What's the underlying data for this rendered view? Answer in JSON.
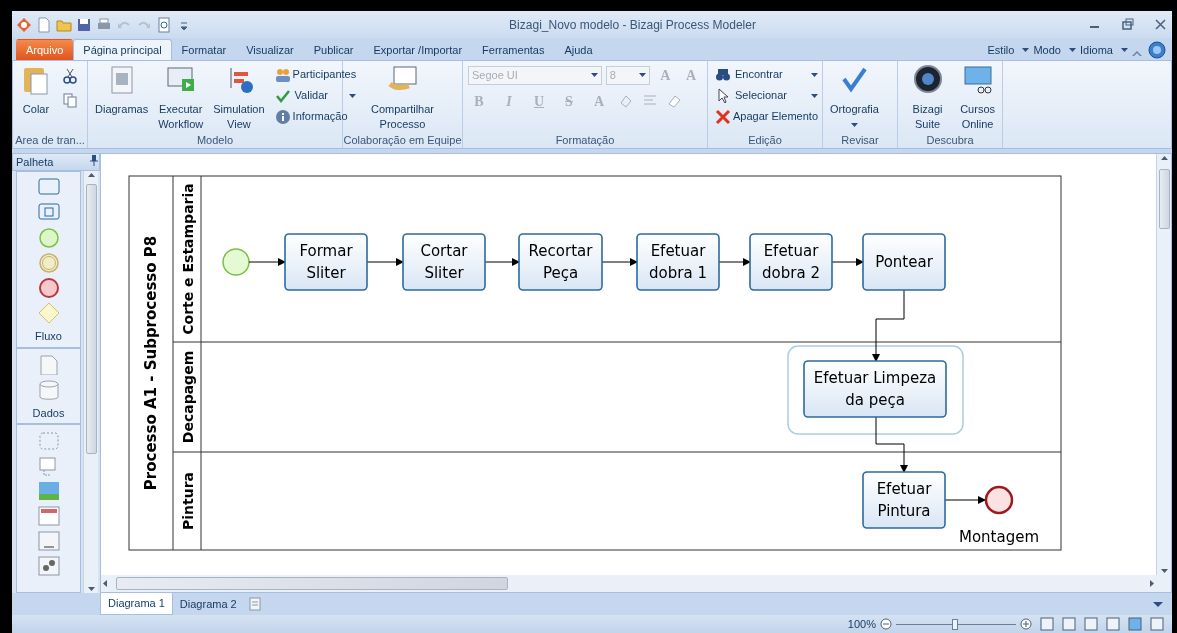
{
  "window": {
    "title": "Bizagi_Novo modelo - Bizagi Process Modeler"
  },
  "tabs": [
    {
      "label": "Arquivo",
      "kind": "file",
      "selected": false
    },
    {
      "label": "Página principal",
      "kind": "tab",
      "selected": true
    },
    {
      "label": "Formatar",
      "kind": "tab",
      "selected": false
    },
    {
      "label": "Visualizar",
      "kind": "tab",
      "selected": false
    },
    {
      "label": "Publicar",
      "kind": "tab",
      "selected": false
    },
    {
      "label": "Exportar /Importar",
      "kind": "tab",
      "selected": false
    },
    {
      "label": "Ferramentas",
      "kind": "tab",
      "selected": false
    },
    {
      "label": "Ajuda",
      "kind": "tab",
      "selected": false
    }
  ],
  "right_menus": [
    "Estilo",
    "Modo",
    "Idioma"
  ],
  "ribbon": [
    {
      "caption": "Area de tran...",
      "items": [
        {
          "kind": "large",
          "lines": [
            "Colar"
          ]
        },
        {
          "kind": "icon"
        },
        {
          "kind": "icon"
        }
      ]
    },
    {
      "caption": "Modelo",
      "items": [
        {
          "kind": "large",
          "lines": [
            "Diagramas"
          ]
        },
        {
          "kind": "large",
          "lines": [
            "Executar",
            "Workflow"
          ]
        },
        {
          "kind": "large",
          "lines": [
            "Simulation",
            "View"
          ]
        },
        {
          "kind": "small",
          "label": "Participantes",
          "dropdown": false
        },
        {
          "kind": "small",
          "label": "Validar",
          "dropdown": true
        },
        {
          "kind": "small",
          "label": "Informação",
          "dropdown": false
        }
      ]
    },
    {
      "caption": "Colaboração em Equipe",
      "items": [
        {
          "kind": "large",
          "lines": [
            "Compartilhar Processo"
          ]
        }
      ]
    },
    {
      "caption": "Formatação",
      "fields": [
        {
          "value": "Segoe UI",
          "disabled": true
        },
        {
          "value": "8",
          "disabled": true
        }
      ],
      "buttons": [
        {
          "kind": "glyph",
          "label": "A",
          "disabled": true
        },
        {
          "kind": "glyph",
          "label": "A",
          "disabled": true
        },
        {
          "kind": "glyph",
          "label": "B",
          "disabled": true
        },
        {
          "kind": "glyph",
          "label": "I",
          "disabled": true
        },
        {
          "kind": "glyph",
          "label": "U",
          "disabled": true
        },
        {
          "kind": "glyph",
          "label": "S",
          "disabled": true
        },
        {
          "kind": "glyph",
          "label": "A",
          "disabled": true
        },
        {
          "kind": "icon",
          "disabled": true
        },
        {
          "kind": "icon",
          "disabled": true
        },
        {
          "kind": "icon",
          "disabled": true
        }
      ]
    },
    {
      "caption": "Edição",
      "items": [
        {
          "kind": "small",
          "label": "Encontrar",
          "dropdown": true
        },
        {
          "kind": "small",
          "label": "Selecionar",
          "dropdown": true
        },
        {
          "kind": "small",
          "label": "Apagar Elemento",
          "dropdown": false
        }
      ]
    },
    {
      "caption": "Revisar",
      "items": [
        {
          "kind": "large",
          "lines": [
            "Ortografia"
          ],
          "dropdown": true
        }
      ]
    },
    {
      "caption": "Descubra",
      "items": [
        {
          "kind": "large",
          "lines": [
            "Bizagi Suite"
          ]
        },
        {
          "kind": "large",
          "lines": [
            "Cursos",
            "Online"
          ]
        }
      ]
    }
  ],
  "palette": {
    "title": "Palheta",
    "sections": [
      "Fluxo",
      "Dados"
    ]
  },
  "diagram": {
    "pool": "Processo A1 - Subprocesso P8",
    "lanes": [
      "Corte e Estamparia",
      "Decapagem",
      "Pintura"
    ],
    "tasks": [
      {
        "lines": [
          "Formar",
          "Sliter"
        ]
      },
      {
        "lines": [
          "Cortar",
          "Sliter"
        ]
      },
      {
        "lines": [
          "Recortar",
          "Peça"
        ]
      },
      {
        "lines": [
          "Efetuar",
          "dobra 1"
        ]
      },
      {
        "lines": [
          "Efetuar",
          "dobra 2"
        ]
      },
      {
        "lines": [
          "Pontear"
        ]
      },
      {
        "lines": [
          "Efetuar Limpeza",
          "da peça"
        ]
      },
      {
        "lines": [
          "Efetuar",
          "Pintura"
        ]
      }
    ],
    "end_event": {
      "label": "Montagem"
    }
  },
  "diagram_tabs": [
    {
      "label": "Diagrama 1",
      "selected": true
    },
    {
      "label": "Diagrama 2",
      "selected": false
    }
  ],
  "status": {
    "zoom": "100%",
    "level": 0.49
  }
}
